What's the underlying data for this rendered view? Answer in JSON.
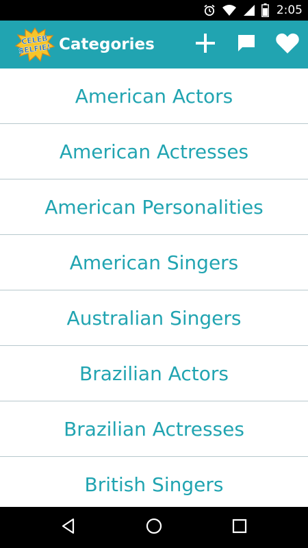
{
  "status_bar": {
    "time": "2:05",
    "icons": [
      "alarm-icon",
      "wifi-icon",
      "cell-signal-icon",
      "battery-icon"
    ]
  },
  "app_bar": {
    "logo_text": [
      "CELEB",
      "SELFIE!"
    ],
    "title": "Categories",
    "actions": [
      "add-icon",
      "chat-icon",
      "heart-icon"
    ]
  },
  "categories": [
    "American Actors",
    "American Actresses",
    "American Personalities",
    "American Singers",
    "Australian Singers",
    "Brazilian Actors",
    "Brazilian Actresses",
    "British Singers"
  ],
  "nav_bar": {
    "buttons": [
      "back-icon",
      "home-icon",
      "recents-icon"
    ]
  },
  "colors": {
    "accent": "#21a4b1",
    "divider": "#b7c8cd",
    "status_bar": "#000000",
    "nav_bar": "#000000",
    "logo_yellow": "#f6c52a",
    "logo_blue": "#2b6fb7"
  }
}
